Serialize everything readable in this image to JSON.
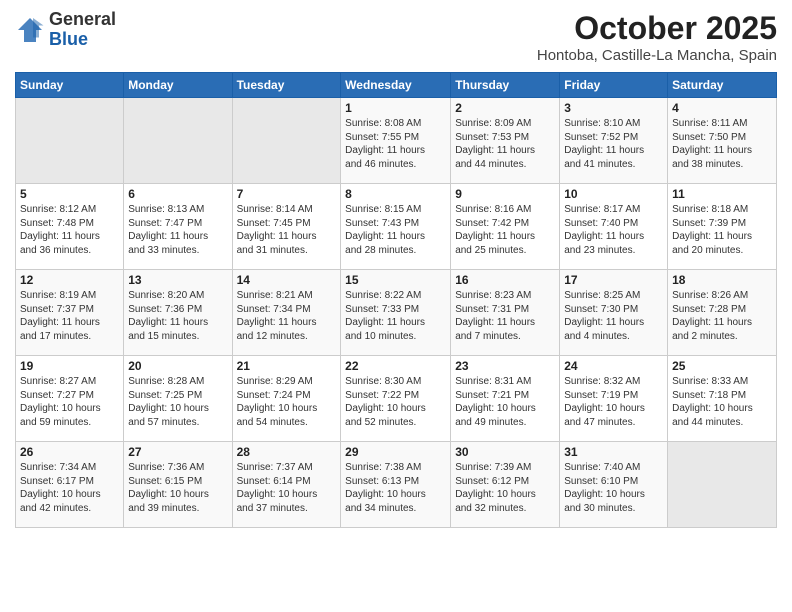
{
  "header": {
    "logo_general": "General",
    "logo_blue": "Blue",
    "month": "October 2025",
    "location": "Hontoba, Castille-La Mancha, Spain"
  },
  "weekdays": [
    "Sunday",
    "Monday",
    "Tuesday",
    "Wednesday",
    "Thursday",
    "Friday",
    "Saturday"
  ],
  "weeks": [
    [
      {
        "day": "",
        "info": ""
      },
      {
        "day": "",
        "info": ""
      },
      {
        "day": "",
        "info": ""
      },
      {
        "day": "1",
        "info": "Sunrise: 8:08 AM\nSunset: 7:55 PM\nDaylight: 11 hours\nand 46 minutes."
      },
      {
        "day": "2",
        "info": "Sunrise: 8:09 AM\nSunset: 7:53 PM\nDaylight: 11 hours\nand 44 minutes."
      },
      {
        "day": "3",
        "info": "Sunrise: 8:10 AM\nSunset: 7:52 PM\nDaylight: 11 hours\nand 41 minutes."
      },
      {
        "day": "4",
        "info": "Sunrise: 8:11 AM\nSunset: 7:50 PM\nDaylight: 11 hours\nand 38 minutes."
      }
    ],
    [
      {
        "day": "5",
        "info": "Sunrise: 8:12 AM\nSunset: 7:48 PM\nDaylight: 11 hours\nand 36 minutes."
      },
      {
        "day": "6",
        "info": "Sunrise: 8:13 AM\nSunset: 7:47 PM\nDaylight: 11 hours\nand 33 minutes."
      },
      {
        "day": "7",
        "info": "Sunrise: 8:14 AM\nSunset: 7:45 PM\nDaylight: 11 hours\nand 31 minutes."
      },
      {
        "day": "8",
        "info": "Sunrise: 8:15 AM\nSunset: 7:43 PM\nDaylight: 11 hours\nand 28 minutes."
      },
      {
        "day": "9",
        "info": "Sunrise: 8:16 AM\nSunset: 7:42 PM\nDaylight: 11 hours\nand 25 minutes."
      },
      {
        "day": "10",
        "info": "Sunrise: 8:17 AM\nSunset: 7:40 PM\nDaylight: 11 hours\nand 23 minutes."
      },
      {
        "day": "11",
        "info": "Sunrise: 8:18 AM\nSunset: 7:39 PM\nDaylight: 11 hours\nand 20 minutes."
      }
    ],
    [
      {
        "day": "12",
        "info": "Sunrise: 8:19 AM\nSunset: 7:37 PM\nDaylight: 11 hours\nand 17 minutes."
      },
      {
        "day": "13",
        "info": "Sunrise: 8:20 AM\nSunset: 7:36 PM\nDaylight: 11 hours\nand 15 minutes."
      },
      {
        "day": "14",
        "info": "Sunrise: 8:21 AM\nSunset: 7:34 PM\nDaylight: 11 hours\nand 12 minutes."
      },
      {
        "day": "15",
        "info": "Sunrise: 8:22 AM\nSunset: 7:33 PM\nDaylight: 11 hours\nand 10 minutes."
      },
      {
        "day": "16",
        "info": "Sunrise: 8:23 AM\nSunset: 7:31 PM\nDaylight: 11 hours\nand 7 minutes."
      },
      {
        "day": "17",
        "info": "Sunrise: 8:25 AM\nSunset: 7:30 PM\nDaylight: 11 hours\nand 4 minutes."
      },
      {
        "day": "18",
        "info": "Sunrise: 8:26 AM\nSunset: 7:28 PM\nDaylight: 11 hours\nand 2 minutes."
      }
    ],
    [
      {
        "day": "19",
        "info": "Sunrise: 8:27 AM\nSunset: 7:27 PM\nDaylight: 10 hours\nand 59 minutes."
      },
      {
        "day": "20",
        "info": "Sunrise: 8:28 AM\nSunset: 7:25 PM\nDaylight: 10 hours\nand 57 minutes."
      },
      {
        "day": "21",
        "info": "Sunrise: 8:29 AM\nSunset: 7:24 PM\nDaylight: 10 hours\nand 54 minutes."
      },
      {
        "day": "22",
        "info": "Sunrise: 8:30 AM\nSunset: 7:22 PM\nDaylight: 10 hours\nand 52 minutes."
      },
      {
        "day": "23",
        "info": "Sunrise: 8:31 AM\nSunset: 7:21 PM\nDaylight: 10 hours\nand 49 minutes."
      },
      {
        "day": "24",
        "info": "Sunrise: 8:32 AM\nSunset: 7:19 PM\nDaylight: 10 hours\nand 47 minutes."
      },
      {
        "day": "25",
        "info": "Sunrise: 8:33 AM\nSunset: 7:18 PM\nDaylight: 10 hours\nand 44 minutes."
      }
    ],
    [
      {
        "day": "26",
        "info": "Sunrise: 7:34 AM\nSunset: 6:17 PM\nDaylight: 10 hours\nand 42 minutes."
      },
      {
        "day": "27",
        "info": "Sunrise: 7:36 AM\nSunset: 6:15 PM\nDaylight: 10 hours\nand 39 minutes."
      },
      {
        "day": "28",
        "info": "Sunrise: 7:37 AM\nSunset: 6:14 PM\nDaylight: 10 hours\nand 37 minutes."
      },
      {
        "day": "29",
        "info": "Sunrise: 7:38 AM\nSunset: 6:13 PM\nDaylight: 10 hours\nand 34 minutes."
      },
      {
        "day": "30",
        "info": "Sunrise: 7:39 AM\nSunset: 6:12 PM\nDaylight: 10 hours\nand 32 minutes."
      },
      {
        "day": "31",
        "info": "Sunrise: 7:40 AM\nSunset: 6:10 PM\nDaylight: 10 hours\nand 30 minutes."
      },
      {
        "day": "",
        "info": ""
      }
    ]
  ]
}
